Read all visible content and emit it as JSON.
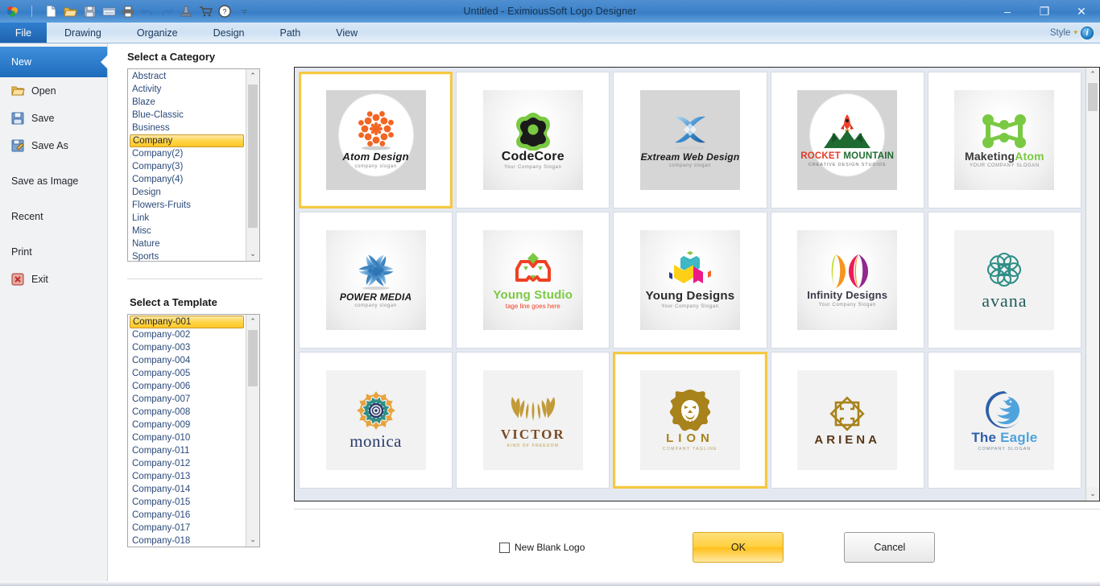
{
  "window": {
    "title": "Untitled - EximiousSoft Logo Designer",
    "minimize": "–",
    "maximize": "❐",
    "close": "✕"
  },
  "quick_access": [
    {
      "name": "app-logo-icon",
      "glyph": "🍁"
    },
    {
      "name": "separator",
      "glyph": "|"
    },
    {
      "name": "new-file-icon",
      "glyph": "📄"
    },
    {
      "name": "open-folder-icon",
      "glyph": "📂"
    },
    {
      "name": "save-icon",
      "glyph": "💾"
    },
    {
      "name": "export-icon",
      "glyph": "▤"
    },
    {
      "name": "print-icon",
      "glyph": "🖨"
    },
    {
      "name": "undo-icon",
      "glyph": "↺"
    },
    {
      "name": "redo-icon",
      "glyph": "↻"
    },
    {
      "name": "stamp-icon",
      "glyph": "⚱"
    },
    {
      "name": "cart-icon",
      "glyph": "🛒"
    },
    {
      "name": "help-icon",
      "glyph": "?"
    },
    {
      "name": "customize-chevron-icon",
      "glyph": "▾"
    }
  ],
  "ribbon": {
    "tabs": [
      {
        "label": "File",
        "active": true
      },
      {
        "label": "Drawing",
        "active": false
      },
      {
        "label": "Organize",
        "active": false
      },
      {
        "label": "Design",
        "active": false
      },
      {
        "label": "Path",
        "active": false
      },
      {
        "label": "View",
        "active": false
      }
    ],
    "style_label": "Style",
    "style_chevron": "▾",
    "info_glyph": "i"
  },
  "sidebar": {
    "items": [
      {
        "label": "New",
        "icon": "",
        "selected": true
      },
      {
        "label": "Open",
        "icon": "open-folder-icon",
        "selected": false
      },
      {
        "label": "Save",
        "icon": "save-disk-icon",
        "selected": false
      },
      {
        "label": "Save As",
        "icon": "save-as-icon",
        "selected": false
      },
      {
        "label": "Save as Image",
        "icon": "",
        "selected": false
      },
      {
        "label": "Recent",
        "icon": "",
        "selected": false
      },
      {
        "label": "Print",
        "icon": "",
        "selected": false
      },
      {
        "label": "Exit",
        "icon": "exit-icon",
        "selected": false
      }
    ]
  },
  "category_panel": {
    "title": "Select a Category",
    "selected": "Company",
    "items": [
      "Abstract",
      "Activity",
      "Blaze",
      "Blue-Classic",
      "Business",
      "Company",
      "Company(2)",
      "Company(3)",
      "Company(4)",
      "Design",
      "Flowers-Fruits",
      "Link",
      "Misc",
      "Nature",
      "Sports"
    ],
    "scroll_up": "⌃",
    "scroll_down": "⌄"
  },
  "template_panel": {
    "title": "Select a Template",
    "selected": "Company-001",
    "items": [
      "Company-001",
      "Company-002",
      "Company-003",
      "Company-004",
      "Company-005",
      "Company-006",
      "Company-007",
      "Company-008",
      "Company-009",
      "Company-010",
      "Company-011",
      "Company-012",
      "Company-013",
      "Company-014",
      "Company-015",
      "Company-016",
      "Company-017",
      "Company-018"
    ],
    "scroll_up": "⌃",
    "scroll_down": "⌄"
  },
  "gallery": {
    "scroll_up": "⌃",
    "scroll_down": "⌄",
    "items": [
      {
        "name": "Atom Design",
        "tagline": "company slogan",
        "selected": true,
        "bg": "oval"
      },
      {
        "name": "CodeCore",
        "tagline": "Your Company Slogan",
        "selected": false,
        "bg": "radial"
      },
      {
        "name": "Extream Web Design",
        "tagline": "company slogan",
        "selected": false,
        "bg": "grey"
      },
      {
        "name": "ROCKET MOUNTAIN",
        "tagline": "CREATIVE DESIGN STUDIOS",
        "selected": false,
        "bg": "oval"
      },
      {
        "name": "MaketingAtom",
        "tagline": "YOUR COMPANY SLOGAN",
        "selected": false,
        "bg": "radial"
      },
      {
        "name": "POWER MEDIA",
        "tagline": "company slogan",
        "selected": false,
        "bg": "radial"
      },
      {
        "name": "Young Studio",
        "tagline": "tage line goes here",
        "selected": false,
        "bg": "radial"
      },
      {
        "name": "Young Designs",
        "tagline": "Your Company Slogan",
        "selected": false,
        "bg": "radial"
      },
      {
        "name": "Infinity Designs",
        "tagline": "Your Company Slogan",
        "selected": false,
        "bg": "radial"
      },
      {
        "name": "avana",
        "tagline": "",
        "selected": false,
        "bg": "flat"
      },
      {
        "name": "monica",
        "tagline": "",
        "selected": false,
        "bg": "flat"
      },
      {
        "name": "VICTOR",
        "tagline": "KIND OF FREEDOM",
        "selected": false,
        "bg": "flat"
      },
      {
        "name": "LION",
        "tagline": "COMPANY TAGLINE",
        "selected": true,
        "bg": "flat"
      },
      {
        "name": "ARIENA",
        "tagline": "",
        "selected": false,
        "bg": "flat"
      },
      {
        "name": "The Eagle",
        "tagline": "COMPANY SLOGAN",
        "selected": false,
        "bg": "flat"
      }
    ]
  },
  "footer": {
    "checkbox_label": "New Blank Logo",
    "checkbox_checked": false,
    "ok_label": "OK",
    "cancel_label": "Cancel"
  },
  "colors": {
    "accent_blue": "#2f7fd0",
    "select_gold": "#ffcf3e",
    "title_blue": "#3f83c9"
  }
}
